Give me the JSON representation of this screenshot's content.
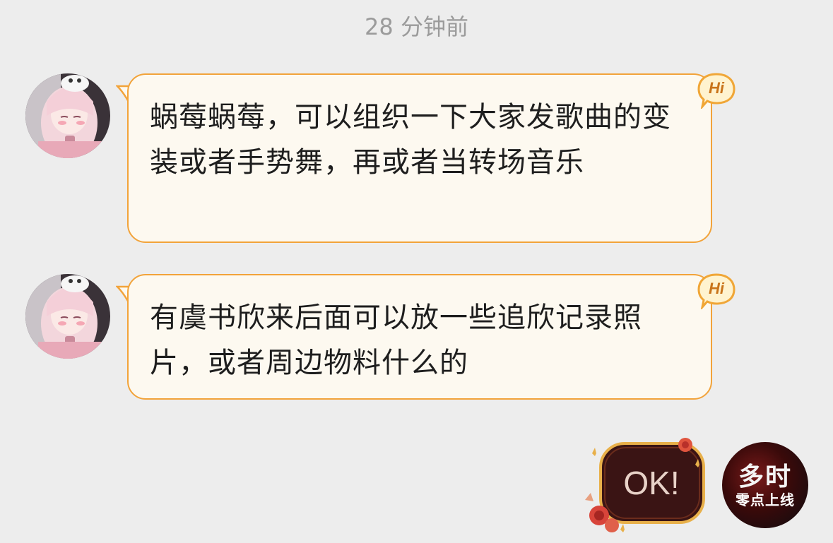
{
  "timestamp": "28 分钟前",
  "messages": [
    {
      "sender": "other",
      "text": "蜗莓蜗莓，可以组织一下大家发歌曲的变装或者手势舞，再或者当转场音乐",
      "badge": "Hi"
    },
    {
      "sender": "other",
      "text": "有虞书欣来后面可以放一些追欣记录照片，或者周边物料什么的",
      "badge": "Hi"
    }
  ],
  "reply": {
    "sticker_text": "OK!",
    "avatar_line1": "多时",
    "avatar_line2": "零点上线"
  },
  "colors": {
    "background": "#ededed",
    "bubble_fill": "#fdf9f0",
    "bubble_border": "#f2a33a",
    "timestamp": "#9b9b9b"
  }
}
